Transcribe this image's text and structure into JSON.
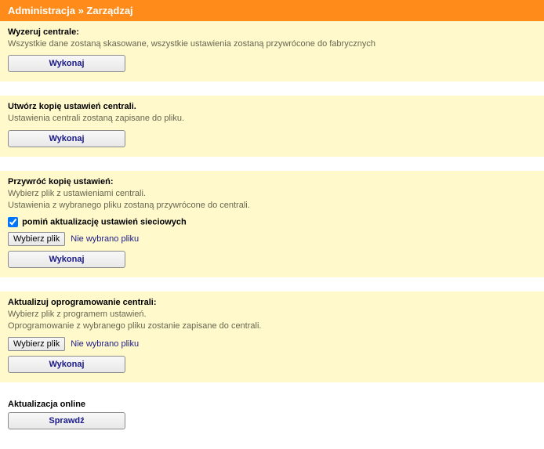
{
  "header": {
    "breadcrumb": "Administracja » Zarządzaj"
  },
  "reset": {
    "title": "Wyzeruj centrale:",
    "desc": "Wszystkie dane zostaną skasowane, wszystkie ustawienia zostaną przywrócone do fabrycznych",
    "button": "Wykonaj"
  },
  "backup": {
    "title": "Utwórz kopię ustawień centrali.",
    "desc": "Ustawienia centrali zostaną zapisane do pliku.",
    "button": "Wykonaj"
  },
  "restore": {
    "title": "Przywróć kopię ustawień:",
    "desc1": "Wybierz plik z ustawieniami centrali.",
    "desc2": "Ustawienia z wybranego pliku zostaną przywrócone do centrali.",
    "checkbox_label": "pomiń aktualizację ustawień sieciowych",
    "file_button": "Wybierz plik",
    "file_status": "Nie wybrano pliku",
    "button": "Wykonaj"
  },
  "firmware": {
    "title": "Aktualizuj oprogramowanie centrali:",
    "desc1": "Wybierz plik z programem ustawień.",
    "desc2": "Oprogramowanie z wybranego pliku zostanie zapisane do centrali.",
    "file_button": "Wybierz plik",
    "file_status": "Nie wybrano pliku",
    "button": "Wykonaj"
  },
  "online": {
    "title": "Aktualizacja online",
    "button": "Sprawdź"
  }
}
